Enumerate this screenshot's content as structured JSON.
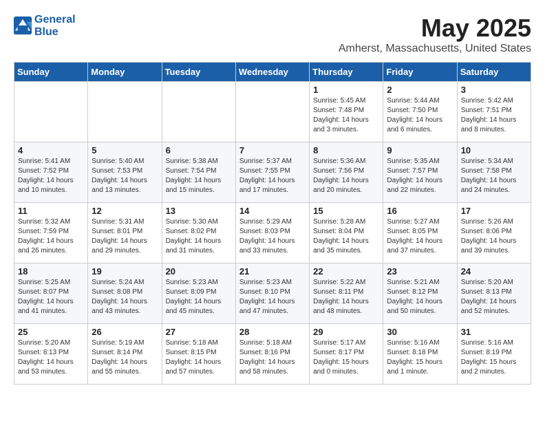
{
  "logo": {
    "line1": "General",
    "line2": "Blue"
  },
  "title": "May 2025",
  "location": "Amherst, Massachusetts, United States",
  "days_of_week": [
    "Sunday",
    "Monday",
    "Tuesday",
    "Wednesday",
    "Thursday",
    "Friday",
    "Saturday"
  ],
  "weeks": [
    [
      {
        "day": "",
        "info": ""
      },
      {
        "day": "",
        "info": ""
      },
      {
        "day": "",
        "info": ""
      },
      {
        "day": "",
        "info": ""
      },
      {
        "day": "1",
        "info": "Sunrise: 5:45 AM\nSunset: 7:48 PM\nDaylight: 14 hours\nand 3 minutes."
      },
      {
        "day": "2",
        "info": "Sunrise: 5:44 AM\nSunset: 7:50 PM\nDaylight: 14 hours\nand 6 minutes."
      },
      {
        "day": "3",
        "info": "Sunrise: 5:42 AM\nSunset: 7:51 PM\nDaylight: 14 hours\nand 8 minutes."
      }
    ],
    [
      {
        "day": "4",
        "info": "Sunrise: 5:41 AM\nSunset: 7:52 PM\nDaylight: 14 hours\nand 10 minutes."
      },
      {
        "day": "5",
        "info": "Sunrise: 5:40 AM\nSunset: 7:53 PM\nDaylight: 14 hours\nand 13 minutes."
      },
      {
        "day": "6",
        "info": "Sunrise: 5:38 AM\nSunset: 7:54 PM\nDaylight: 14 hours\nand 15 minutes."
      },
      {
        "day": "7",
        "info": "Sunrise: 5:37 AM\nSunset: 7:55 PM\nDaylight: 14 hours\nand 17 minutes."
      },
      {
        "day": "8",
        "info": "Sunrise: 5:36 AM\nSunset: 7:56 PM\nDaylight: 14 hours\nand 20 minutes."
      },
      {
        "day": "9",
        "info": "Sunrise: 5:35 AM\nSunset: 7:57 PM\nDaylight: 14 hours\nand 22 minutes."
      },
      {
        "day": "10",
        "info": "Sunrise: 5:34 AM\nSunset: 7:58 PM\nDaylight: 14 hours\nand 24 minutes."
      }
    ],
    [
      {
        "day": "11",
        "info": "Sunrise: 5:32 AM\nSunset: 7:59 PM\nDaylight: 14 hours\nand 26 minutes."
      },
      {
        "day": "12",
        "info": "Sunrise: 5:31 AM\nSunset: 8:01 PM\nDaylight: 14 hours\nand 29 minutes."
      },
      {
        "day": "13",
        "info": "Sunrise: 5:30 AM\nSunset: 8:02 PM\nDaylight: 14 hours\nand 31 minutes."
      },
      {
        "day": "14",
        "info": "Sunrise: 5:29 AM\nSunset: 8:03 PM\nDaylight: 14 hours\nand 33 minutes."
      },
      {
        "day": "15",
        "info": "Sunrise: 5:28 AM\nSunset: 8:04 PM\nDaylight: 14 hours\nand 35 minutes."
      },
      {
        "day": "16",
        "info": "Sunrise: 5:27 AM\nSunset: 8:05 PM\nDaylight: 14 hours\nand 37 minutes."
      },
      {
        "day": "17",
        "info": "Sunrise: 5:26 AM\nSunset: 8:06 PM\nDaylight: 14 hours\nand 39 minutes."
      }
    ],
    [
      {
        "day": "18",
        "info": "Sunrise: 5:25 AM\nSunset: 8:07 PM\nDaylight: 14 hours\nand 41 minutes."
      },
      {
        "day": "19",
        "info": "Sunrise: 5:24 AM\nSunset: 8:08 PM\nDaylight: 14 hours\nand 43 minutes."
      },
      {
        "day": "20",
        "info": "Sunrise: 5:23 AM\nSunset: 8:09 PM\nDaylight: 14 hours\nand 45 minutes."
      },
      {
        "day": "21",
        "info": "Sunrise: 5:23 AM\nSunset: 8:10 PM\nDaylight: 14 hours\nand 47 minutes."
      },
      {
        "day": "22",
        "info": "Sunrise: 5:22 AM\nSunset: 8:11 PM\nDaylight: 14 hours\nand 48 minutes."
      },
      {
        "day": "23",
        "info": "Sunrise: 5:21 AM\nSunset: 8:12 PM\nDaylight: 14 hours\nand 50 minutes."
      },
      {
        "day": "24",
        "info": "Sunrise: 5:20 AM\nSunset: 8:13 PM\nDaylight: 14 hours\nand 52 minutes."
      }
    ],
    [
      {
        "day": "25",
        "info": "Sunrise: 5:20 AM\nSunset: 8:13 PM\nDaylight: 14 hours\nand 53 minutes."
      },
      {
        "day": "26",
        "info": "Sunrise: 5:19 AM\nSunset: 8:14 PM\nDaylight: 14 hours\nand 55 minutes."
      },
      {
        "day": "27",
        "info": "Sunrise: 5:18 AM\nSunset: 8:15 PM\nDaylight: 14 hours\nand 57 minutes."
      },
      {
        "day": "28",
        "info": "Sunrise: 5:18 AM\nSunset: 8:16 PM\nDaylight: 14 hours\nand 58 minutes."
      },
      {
        "day": "29",
        "info": "Sunrise: 5:17 AM\nSunset: 8:17 PM\nDaylight: 15 hours\nand 0 minutes."
      },
      {
        "day": "30",
        "info": "Sunrise: 5:16 AM\nSunset: 8:18 PM\nDaylight: 15 hours\nand 1 minute."
      },
      {
        "day": "31",
        "info": "Sunrise: 5:16 AM\nSunset: 8:19 PM\nDaylight: 15 hours\nand 2 minutes."
      }
    ]
  ]
}
